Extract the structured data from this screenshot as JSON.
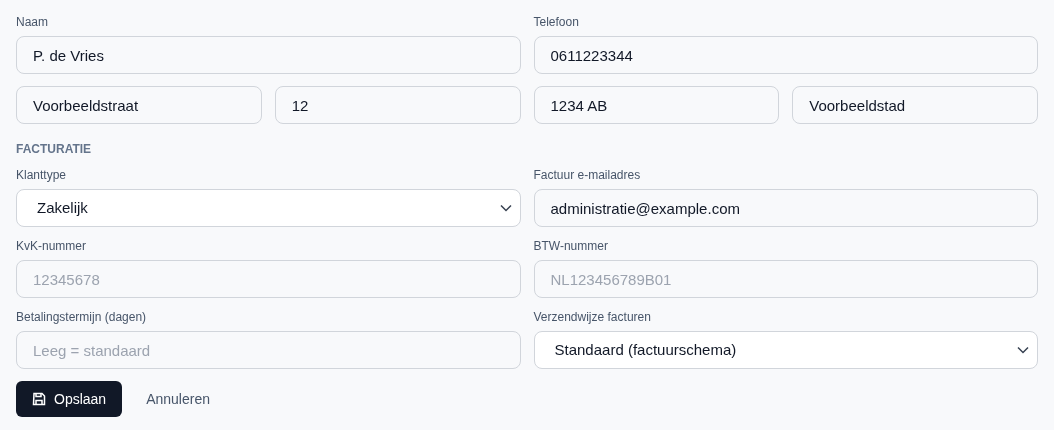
{
  "contact_rows": [
    [
      {
        "kind": "input",
        "label": "Naam",
        "value": "P. de Vries"
      },
      {
        "kind": "input",
        "label": "Telefoon",
        "value": "0611223344"
      }
    ],
    [
      {
        "kind": "input",
        "value": "Voorbeeldstraat"
      },
      {
        "kind": "input",
        "value": "12"
      },
      {
        "kind": "input",
        "value": "1234 AB"
      },
      {
        "kind": "input",
        "value": "Voorbeeldstad"
      }
    ]
  ],
  "billing": {
    "heading": "FACTURATIE",
    "rows": [
      [
        {
          "kind": "select",
          "label": "Klanttype",
          "value": "Zakelijk"
        },
        {
          "kind": "input",
          "label": "Factuur e-mailadres",
          "value": "administratie@example.com"
        }
      ],
      [
        {
          "kind": "input",
          "label": "KvK-nummer",
          "placeholder": "12345678"
        },
        {
          "kind": "input",
          "label": "BTW-nummer",
          "placeholder": "NL123456789B01"
        }
      ],
      [
        {
          "kind": "input",
          "label": "Betalingstermijn (dagen)",
          "placeholder": "Leeg = standaard"
        },
        {
          "kind": "select",
          "label": "Verzendwijze facturen",
          "value": "Standaard (factuurschema)"
        }
      ]
    ]
  },
  "buttons": [
    {
      "kind": "primary",
      "label": "Opslaan"
    },
    {
      "kind": "link",
      "label": "Annuleren"
    }
  ]
}
